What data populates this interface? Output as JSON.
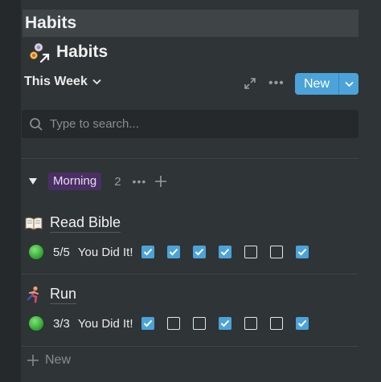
{
  "topbar": {
    "title": "Habits"
  },
  "page": {
    "icon": "habits-database-icon",
    "title": "Habits"
  },
  "view": {
    "selected": "This Week",
    "new_label": "New"
  },
  "search": {
    "placeholder": "Type to search..."
  },
  "group": {
    "label": "Morning",
    "count": "2",
    "color": "#492f64"
  },
  "cards": [
    {
      "icon": "open-book-icon",
      "name": "Read Bible",
      "progress": "5/5",
      "status": "You Did It!",
      "days": [
        true,
        true,
        true,
        true,
        false,
        false,
        true
      ]
    },
    {
      "icon": "runner-icon",
      "name": "Run",
      "progress": "3/3",
      "status": "You Did It!",
      "days": [
        true,
        false,
        false,
        true,
        false,
        false,
        true
      ]
    }
  ],
  "footer": {
    "new_label": "New"
  },
  "colors": {
    "accent": "#4ba3d9",
    "background": "#2f3437",
    "status_dot": "#2ea02a"
  }
}
